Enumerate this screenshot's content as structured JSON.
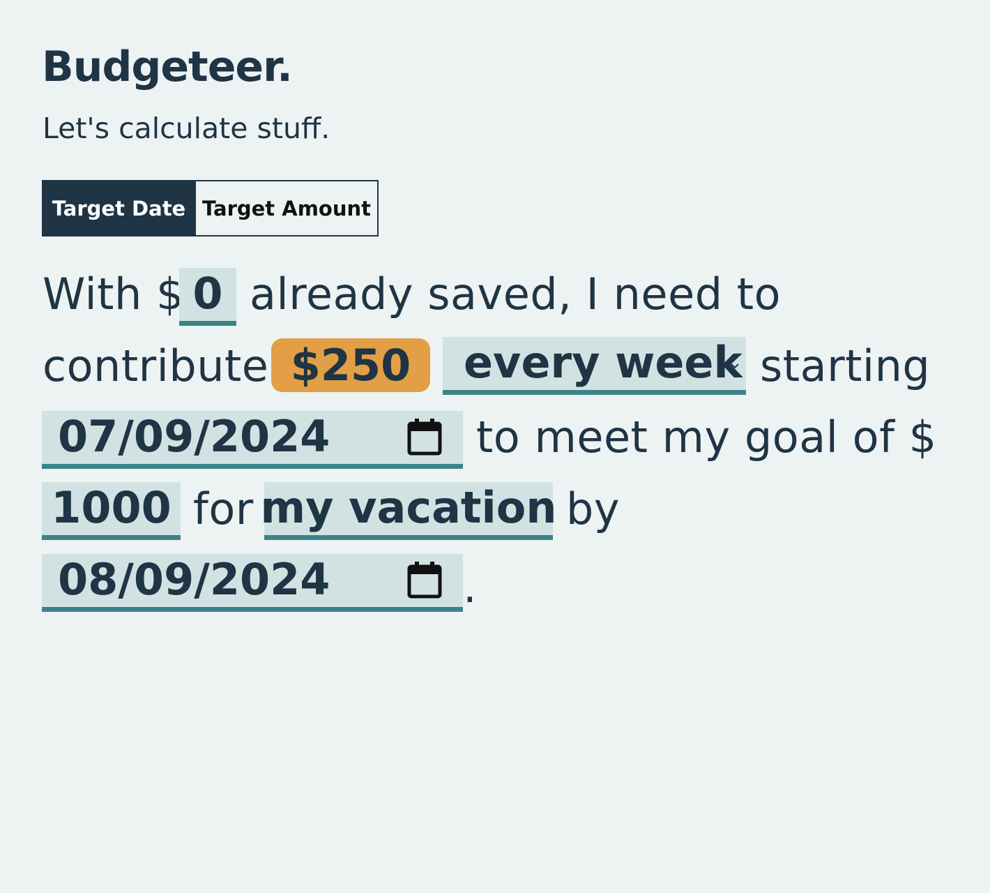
{
  "header": {
    "title": "Budgeteer.",
    "subtitle": "Let's calculate stuff."
  },
  "tabs": [
    {
      "label": "Target Date",
      "active": true
    },
    {
      "label": "Target Amount",
      "active": false
    }
  ],
  "sentence": {
    "with_prefix": "With $",
    "saved_value": "0",
    "already_saved": "already saved, I need to",
    "contribute": "contribute",
    "amount": "$250",
    "frequency": "every week",
    "starting": "starting",
    "start_date": "07/09/2024",
    "meet_goal": "to meet my goal of $",
    "goal_value": "1000",
    "for": "for",
    "goal_name": "my vacation",
    "by": "by",
    "end_date": "08/09/2024",
    "period": "."
  },
  "colors": {
    "background": "#edf3f3",
    "text": "#1f3444",
    "field_bg": "#d2e2e2",
    "field_underline": "#3c8387",
    "amount_badge": "#e39f45",
    "tab_active_bg": "#1f3444"
  },
  "icons": {
    "frequency_dropdown": "chevron-down-icon",
    "date_picker": "calendar-icon"
  }
}
